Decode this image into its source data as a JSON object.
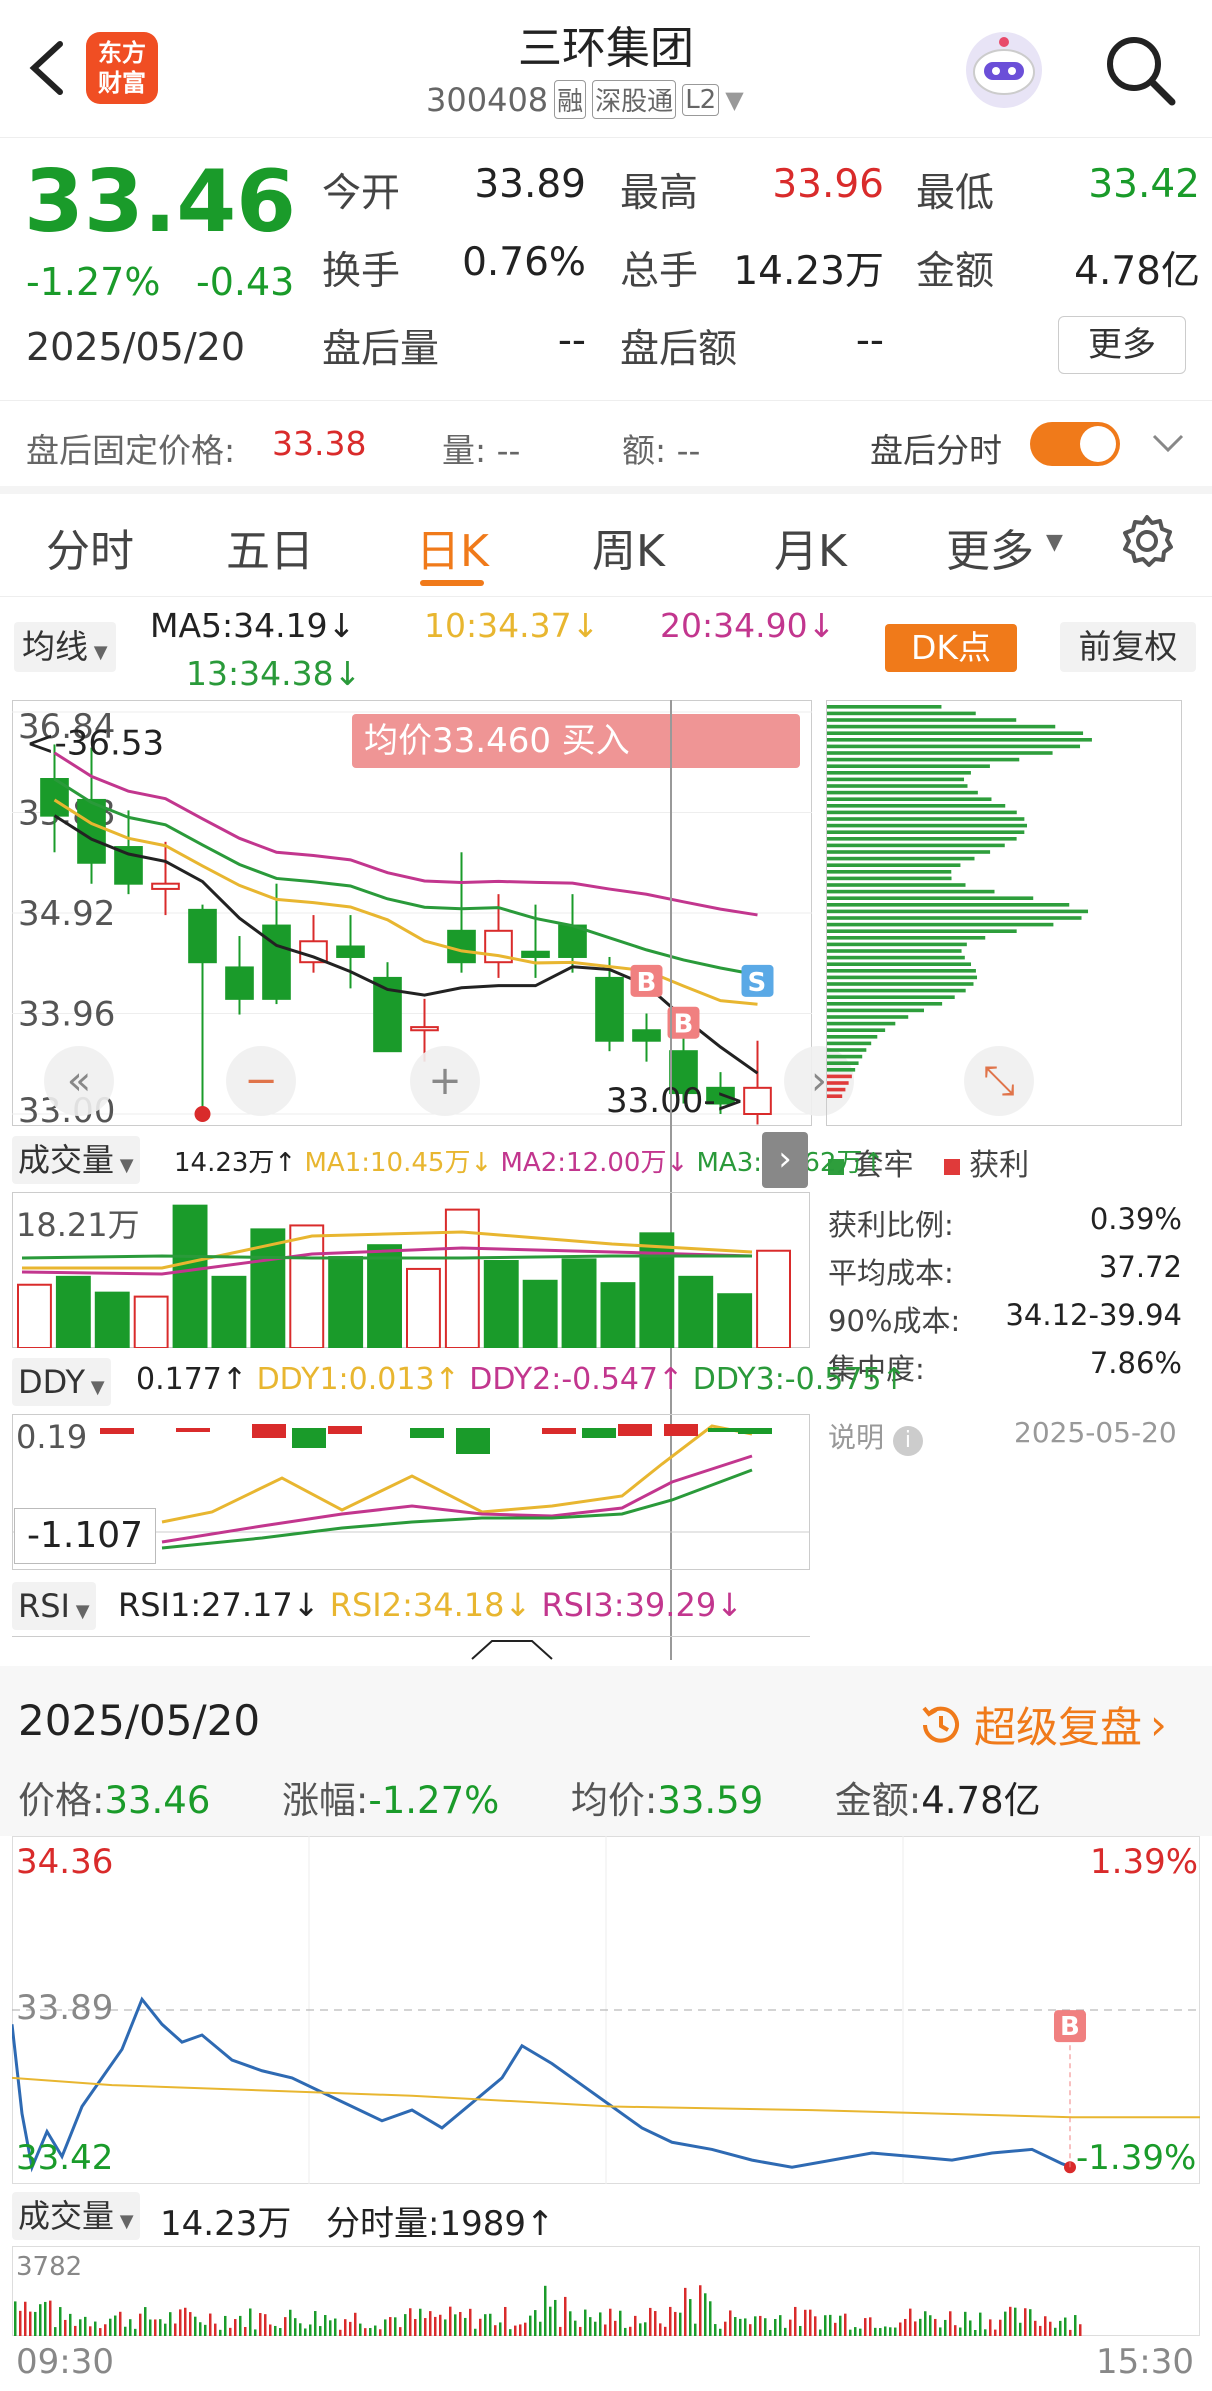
{
  "header": {
    "title": "三环集团",
    "code": "300408",
    "tags": [
      "融",
      "深股通",
      "L2"
    ],
    "logo_line1": "东方",
    "logo_line2": "财富"
  },
  "quote": {
    "price": "33.46",
    "change_pct": "-1.27%",
    "change": "-0.43",
    "date": "2025/05/20",
    "fields": [
      {
        "label": "今开",
        "value": "33.89",
        "color": "#222222"
      },
      {
        "label": "最高",
        "value": "33.96",
        "color": "#d92b2b"
      },
      {
        "label": "最低",
        "value": "33.42",
        "color": "#1a9b2a"
      },
      {
        "label": "换手",
        "value": "0.76%",
        "color": "#222222"
      },
      {
        "label": "总手",
        "value": "14.23万",
        "color": "#222222"
      },
      {
        "label": "金额",
        "value": "4.78亿",
        "color": "#222222"
      },
      {
        "label": "盘后量",
        "value": "--",
        "color": "#222222"
      },
      {
        "label": "盘后额",
        "value": "--",
        "color": "#222222"
      }
    ],
    "more_label": "更多"
  },
  "afterhours": {
    "fixed_label": "盘后固定价格:",
    "fixed_value": "33.38",
    "vol": "量: --",
    "amt": "额: --",
    "toggle_label": "盘后分时",
    "toggle_on": true
  },
  "tabs": [
    "分时",
    "五日",
    "日K",
    "周K",
    "月K",
    "更多"
  ],
  "active_tab": 2,
  "kline": {
    "ma_select": "均线",
    "ma5": "MA5:34.19↓",
    "ma10": "10:34.37↓",
    "ma20": "20:34.90↓",
    "ma13": "13:34.38↓",
    "dk_label": "DK点",
    "adjust_label": "前复权",
    "tooltip": "均价33.460  买入",
    "y_labels": [
      "36.84",
      "35.88",
      "34.92",
      "33.96",
      "33.00"
    ],
    "high_marker": "<-36.53",
    "low_marker": "33.00->",
    "candles": [
      {
        "o": 36.2,
        "c": 35.85,
        "h": 36.53,
        "l": 35.5
      },
      {
        "o": 36.0,
        "c": 35.4,
        "h": 36.5,
        "l": 35.2
      },
      {
        "o": 35.55,
        "c": 35.2,
        "h": 35.9,
        "l": 35.1
      },
      {
        "o": 35.15,
        "c": 35.2,
        "h": 35.6,
        "l": 34.9
      },
      {
        "o": 34.95,
        "c": 34.45,
        "h": 35.0,
        "l": 33.0
      },
      {
        "o": 34.4,
        "c": 34.1,
        "h": 34.7,
        "l": 33.95
      },
      {
        "o": 34.8,
        "c": 34.1,
        "h": 35.2,
        "l": 34.05
      },
      {
        "o": 34.45,
        "c": 34.65,
        "h": 34.9,
        "l": 34.35
      },
      {
        "o": 34.6,
        "c": 34.5,
        "h": 34.9,
        "l": 34.2
      },
      {
        "o": 34.3,
        "c": 33.6,
        "h": 34.45,
        "l": 33.6
      },
      {
        "o": 33.8,
        "c": 33.83,
        "h": 34.1,
        "l": 33.5
      },
      {
        "o": 34.75,
        "c": 34.45,
        "h": 35.5,
        "l": 34.35
      },
      {
        "o": 34.45,
        "c": 34.75,
        "h": 35.1,
        "l": 34.3
      },
      {
        "o": 34.55,
        "c": 34.5,
        "h": 35.0,
        "l": 34.3
      },
      {
        "o": 34.8,
        "c": 34.5,
        "h": 35.1,
        "l": 34.35
      },
      {
        "o": 34.3,
        "c": 33.7,
        "h": 34.5,
        "l": 33.6
      },
      {
        "o": 33.8,
        "c": 33.7,
        "h": 33.96,
        "l": 33.5
      },
      {
        "o": 33.6,
        "c": 33.2,
        "h": 33.8,
        "l": 33.1
      },
      {
        "o": 33.25,
        "c": 33.1,
        "h": 33.4,
        "l": 33.0
      },
      {
        "o": 33.0,
        "c": 33.25,
        "h": 33.7,
        "l": 32.9
      }
    ],
    "chip_legend": [
      {
        "label": "套牢",
        "color": "#2e9e3c"
      },
      {
        "label": "获利",
        "color": "#e03a3a"
      }
    ],
    "chip_stats": [
      {
        "label": "获利比例:",
        "value": "0.39%"
      },
      {
        "label": "平均成本:",
        "value": "37.72"
      },
      {
        "label": "90%成本:",
        "value": "34.12-39.94"
      },
      {
        "label": "集中度:",
        "value": "7.86%"
      }
    ],
    "explain_label": "说明",
    "chip_date": "2025-05-20"
  },
  "volume": {
    "select": "成交量",
    "value": "14.23万↑",
    "ma1": "MA1:10.45万↓",
    "ma2": "MA2:12.00万↓",
    "ma3": "MA3:10.62万↑",
    "ymax_label": "18.21万",
    "bars": [
      {
        "v": 8.0,
        "up": true
      },
      {
        "v": 9.0,
        "up": false
      },
      {
        "v": 7.0,
        "up": false
      },
      {
        "v": 6.5,
        "up": true
      },
      {
        "v": 18.0,
        "up": false
      },
      {
        "v": 9.0,
        "up": false
      },
      {
        "v": 15.0,
        "up": false
      },
      {
        "v": 15.5,
        "up": true
      },
      {
        "v": 11.5,
        "up": false
      },
      {
        "v": 13.0,
        "up": false
      },
      {
        "v": 10.0,
        "up": true
      },
      {
        "v": 17.5,
        "up": true
      },
      {
        "v": 11.0,
        "up": false
      },
      {
        "v": 8.5,
        "up": false
      },
      {
        "v": 11.2,
        "up": false
      },
      {
        "v": 8.2,
        "up": false
      },
      {
        "v": 14.5,
        "up": false
      },
      {
        "v": 9.0,
        "up": false
      },
      {
        "v": 6.8,
        "up": false
      },
      {
        "v": 12.3,
        "up": true
      }
    ]
  },
  "ddy": {
    "select": "DDY",
    "value": "0.177↑",
    "ddy1": "DDY1:0.013↑",
    "ddy2": "DDY2:-0.547↑",
    "ddy3": "DDY3:-0.575↑",
    "top_label": "0.19",
    "bottom_label": "-1.107"
  },
  "rsi": {
    "select": "RSI",
    "rsi1": "RSI1:27.17↓",
    "rsi2": "RSI2:34.18↓",
    "rsi3": "RSI3:39.29↓"
  },
  "intraday": {
    "date": "2025/05/20",
    "replay_label": "超级复盘",
    "price_label": "价格:",
    "price": "33.46",
    "chg_label": "涨幅:",
    "chg": "-1.27%",
    "avg_label": "均价:",
    "avg": "33.59",
    "amt_label": "金额:",
    "amt": "4.78亿",
    "y_top": "34.36",
    "y_mid": "33.89",
    "y_bot": "33.42",
    "pct_top": "1.39%",
    "pct_bot": "-1.39%",
    "vol_select": "成交量",
    "vol_value": "14.23万",
    "tick_vol_label": "分时量:",
    "tick_vol": "1989↑",
    "vol_max": "3782",
    "time_start": "09:30",
    "time_end": "15:30"
  },
  "colors": {
    "up": "#d92b2b",
    "down": "#1a9b2a",
    "accent": "#f07a1a",
    "ma5": "#222222",
    "ma10": "#e8b630",
    "ma20": "#c2368e",
    "ma13": "#2a9a3a"
  }
}
